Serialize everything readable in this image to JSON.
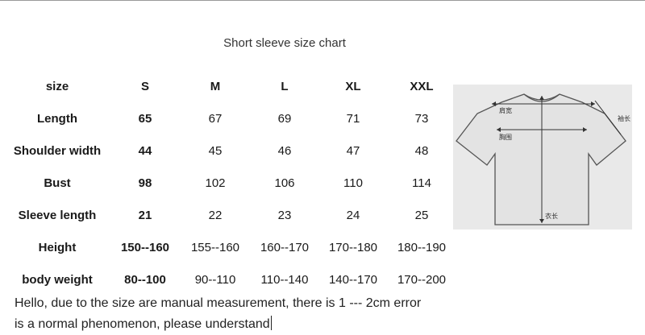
{
  "title": "Short sleeve size chart",
  "table": {
    "rows": [
      {
        "label": "size",
        "cells": [
          "S",
          "M",
          "L",
          "XL",
          "XXL"
        ]
      },
      {
        "label": "Length",
        "cells": [
          "65",
          "67",
          "69",
          "71",
          "73"
        ]
      },
      {
        "label": "Shoulder width",
        "cells": [
          "44",
          "45",
          "46",
          "47",
          "48"
        ]
      },
      {
        "label": "Bust",
        "cells": [
          "98",
          "102",
          "106",
          "110",
          "114"
        ]
      },
      {
        "label": "Sleeve length",
        "cells": [
          "21",
          "22",
          "23",
          "24",
          "25"
        ]
      },
      {
        "label": "Height",
        "cells": [
          "150--160",
          "155--160",
          "160--170",
          "170--180",
          "180--190"
        ]
      },
      {
        "label": "body weight",
        "cells": [
          "80--100",
          "90--110",
          "110--140",
          "140--170",
          "170--200"
        ]
      }
    ]
  },
  "note": {
    "line1": "Hello, due to the size are manual measurement, there is 1 --- 2cm error",
    "line2": "is a normal phenomenon, please understand"
  },
  "diagram": {
    "shoulder_label": "肩宽",
    "chest_label": "胸围",
    "sleeve_label": "袖长",
    "length_label": "衣长"
  }
}
